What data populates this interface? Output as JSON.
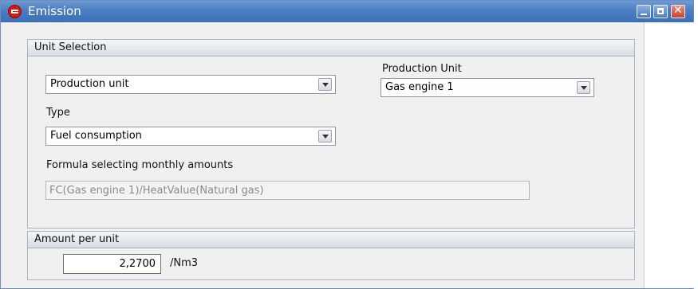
{
  "window": {
    "title": "Emission"
  },
  "unit_selection": {
    "header": "Unit Selection",
    "unit_kind": {
      "value": "Production unit"
    },
    "production_unit": {
      "label": "Production Unit",
      "value": "Gas engine 1"
    },
    "type": {
      "label": "Type",
      "value": "Fuel consumption"
    },
    "formula": {
      "label": "Formula selecting monthly amounts",
      "value": "FC(Gas engine 1)/HeatValue(Natural gas)"
    }
  },
  "amount_per_unit": {
    "header": "Amount per unit",
    "value": "2,2700",
    "unit": "/Nm3"
  }
}
